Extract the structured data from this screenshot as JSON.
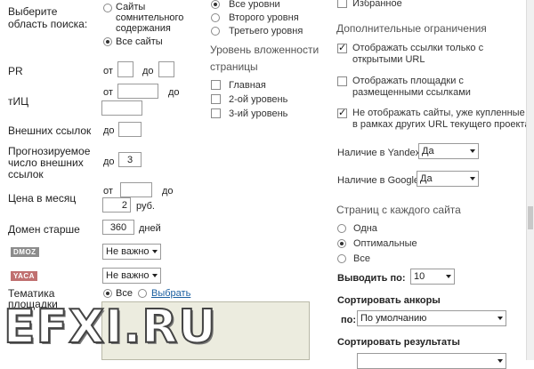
{
  "left": {
    "search_area_label": "Выберите область поиска:",
    "search_area_options": [
      "Сайты сомнительного содержания",
      "Все сайты"
    ],
    "pr_label": "PR",
    "tic_label": "тИЦ",
    "from": "от",
    "to": "до",
    "outbound_links_label": "Внешних ссылок",
    "outbound_links_to": "до",
    "forecast_label": "Прогнозируемое число внешних ссылок",
    "forecast_to": "до",
    "forecast_value": "3",
    "price_label": "Цена в месяц",
    "price_to_value": "2",
    "price_currency": "руб.",
    "domain_age_label": "Домен старше",
    "domain_age_value": "360",
    "domain_age_unit": "дней",
    "dmoz_badge": "DMOZ",
    "yaca_badge": "YACA",
    "dmoz_value": "Не важно",
    "yaca_value": "Не важно",
    "topic_label": "Тематика площадки",
    "topic_all": "Все",
    "topic_choose": "Выбрать"
  },
  "middle": {
    "levels": [
      "Все уровни",
      "Второго уровня",
      "Третьего уровня"
    ],
    "nesting_title": "Уровень вложенности страницы",
    "nesting_options": [
      "Главная",
      "2-ой уровень",
      "3-ий уровень"
    ]
  },
  "right": {
    "favorites_label": "Избранное",
    "extra_title": "Дополнительные ограничения",
    "extra_options": [
      "Отображать ссылки только с открытыми URL",
      "Отображать площадки с размещенными ссылками",
      "Не отображать сайты, уже купленные в рамках других URL текущего проекта"
    ],
    "yandex_label": "Наличие в Yandex",
    "yandex_value": "Да",
    "google_label": "Наличие в Google",
    "google_value": "Да",
    "pages_title": "Страниц с каждого сайта",
    "pages_options": [
      "Одна",
      "Оптимальные",
      "Все"
    ],
    "output_label": "Выводить по:",
    "output_value": "10",
    "sort_anchors_label": "Сортировать анкоры",
    "sort_by_label": "по:",
    "sort_by_value": "По умолчанию",
    "sort_results_label": "Сортировать результаты"
  },
  "watermark": "EFXI.RU",
  "colors": {
    "dmoz": "#8c8c8c",
    "yaca": "#c07070",
    "link": "#1a5fa0"
  }
}
